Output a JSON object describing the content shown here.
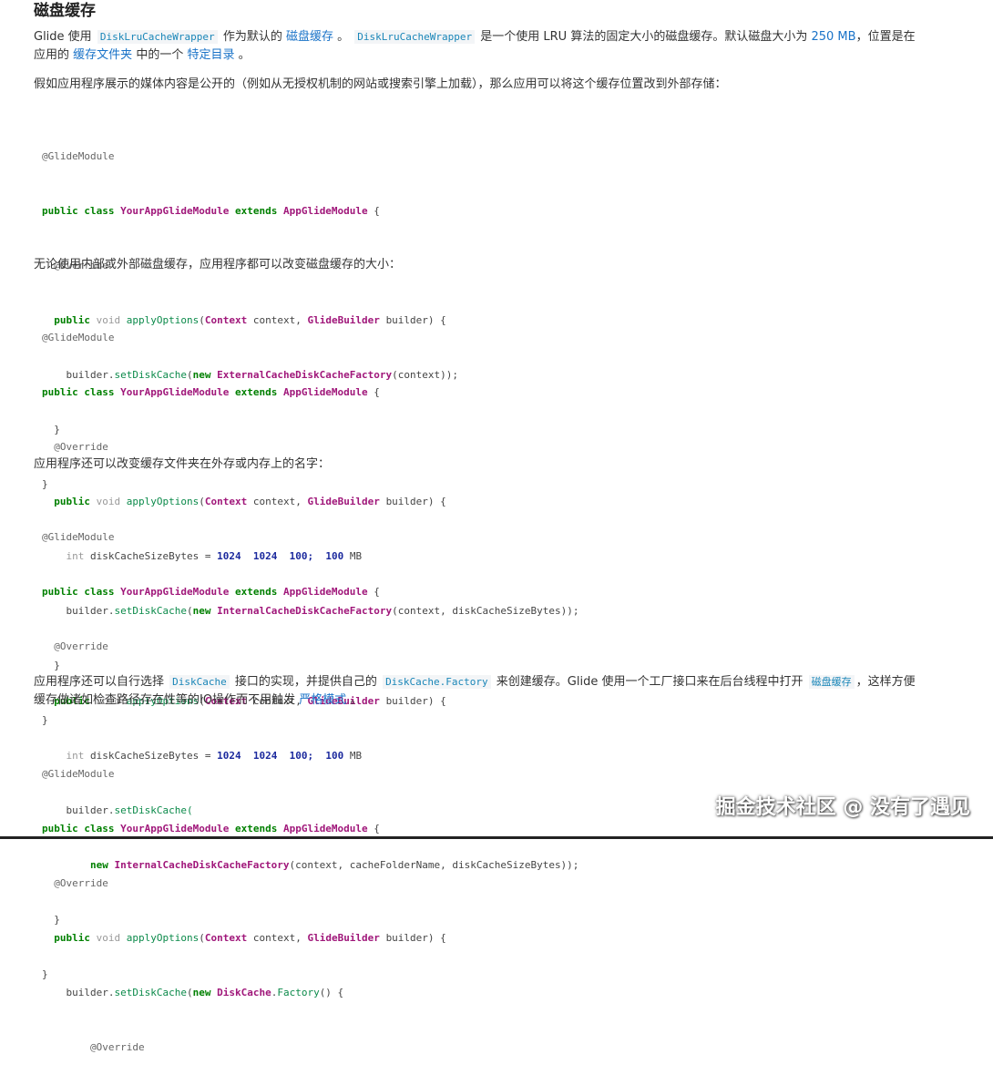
{
  "title": "磁盘缓存",
  "p1": {
    "t1": "Glide 使用",
    "c1": "DiskLruCacheWrapper",
    "t2": "作为默认的",
    "l1": "磁盘缓存",
    "t3": "。",
    "c2": "DiskLruCacheWrapper",
    "t4": "是一个使用 LRU 算法的固定大小的磁盘缓存。默认磁盘大小为",
    "l2": "250 MB",
    "t5": "，位置是在应用的",
    "l3": "缓存文件夹",
    "t6": "中的一个",
    "l4": "特定目录",
    "t7": "。"
  },
  "p2": "假如应用程序展示的媒体内容是公开的（例如从无授权机制的网站或搜索引擎上加载），那么应用可以将这个缓存位置改到外部存储：",
  "p3": "无论使用内部或外部磁盘缓存，应用程序都可以改变磁盘缓存的大小：",
  "p4": "应用程序还可以改变缓存文件夹在外存或内存上的名字：",
  "p5": {
    "t1": "应用程序还可以自行选择",
    "c1": "DiskCache",
    "t2": "接口的实现，并提供自己的",
    "c2": "DiskCache.Factory",
    "t3": "来创建缓存。Glide 使用一个工厂接口来在后台线程中打开",
    "c3": "磁盘缓存",
    "t4": "，这样方便缓存做诸如检查路径存在性等的IO操作而不用触发",
    "l1": "严格模式",
    "t5": "。"
  },
  "code": {
    "annotation": "@GlideModule",
    "kw_public": "public",
    "kw_class": "class",
    "class_name": "YourAppGlideModule",
    "kw_extends": "extends",
    "base_class": "AppGlideModule",
    "brace_open": "{",
    "override": "@Override",
    "kw_void": "void",
    "method": "applyOptions",
    "param_type1": "Context",
    "param1": "context,",
    "param_type2": "GlideBuilder",
    "param2": "builder) {",
    "builder": "builder.",
    "set_disk_cache": "setDiskCache",
    "kw_new": "new",
    "ext_factory": "ExternalCacheDiskCacheFactory",
    "ext_args": "(context));",
    "kw_int": "int",
    "size_var": "diskCacheSizeBytes =",
    "n1": "1024",
    "n2": "1024",
    "n3": "100;",
    "n4": "100",
    "mb": "MB",
    "int_factory": "InternalCacheDiskCacheFactory",
    "int_args": "(context, diskCacheSizeBytes));",
    "set_disk_cache_open": "setDiskCache(",
    "int_args2": "(context, cacheFolderName, diskCacheSizeBytes));",
    "inner_close": "}",
    "outer_close": "}",
    "disk_cache": "DiskCache",
    "factory": "Factory",
    "factory_tail": "() {"
  },
  "watermark": "掘金技术社区 @ 没有了遇见"
}
